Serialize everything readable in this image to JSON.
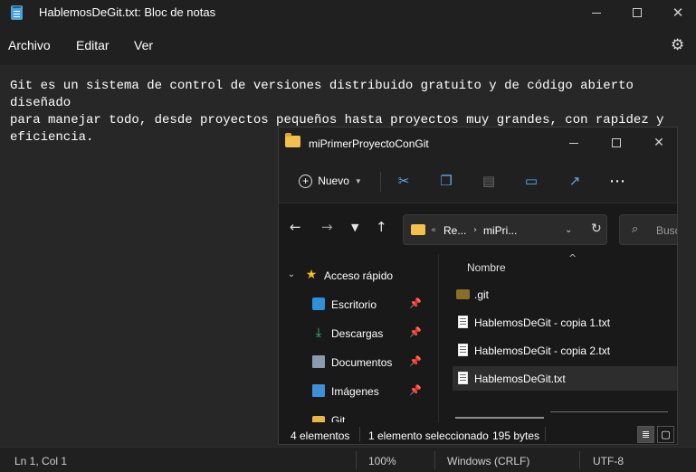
{
  "notepad": {
    "title": "HablemosDeGit.txt: Bloc de notas",
    "menu": [
      "Archivo",
      "Editar",
      "Ver"
    ],
    "content": "Git es un sistema de control de versiones distribuido gratuito y de código abierto diseñado\npara manejar todo, desde proyectos pequeños hasta proyectos muy grandes, con rapidez y\neficiencia.",
    "status": {
      "position": "Ln 1, Col 1",
      "zoom": "100%",
      "line_ending": "Windows (CRLF)",
      "encoding": "UTF-8"
    },
    "icons": {
      "app": "notepad-icon",
      "settings": "gear-icon"
    }
  },
  "explorer": {
    "title": "miPrimerProyectoConGit",
    "toolbar": {
      "new_label": "Nuevo"
    },
    "address": {
      "segment1": "Re...",
      "segment2": "miPri..."
    },
    "search_placeholder": "Busc",
    "sidebar": {
      "quick_access": "Acceso rápido",
      "items": [
        "Escritorio",
        "Descargas",
        "Documentos",
        "Imágenes",
        "Git"
      ]
    },
    "column_header": "Nombre",
    "files": [
      ".git",
      "HablemosDeGit - copia 1.txt",
      "HablemosDeGit - copia 2.txt",
      "HablemosDeGit.txt"
    ],
    "selected_index": 3,
    "status": {
      "count": "4 elementos",
      "selection": "1 elemento seleccionado",
      "size": "195 bytes"
    },
    "colors": {
      "folder": "#f3c04e",
      "star": "#f4c01e"
    }
  }
}
